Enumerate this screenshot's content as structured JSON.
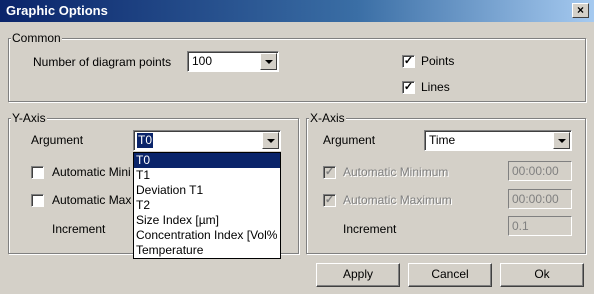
{
  "window": {
    "title": "Graphic Options",
    "close_label": "×"
  },
  "common": {
    "legend": "Common",
    "points_label": "Number of diagram points",
    "points_value": "100",
    "points_checkbox": {
      "label": "Points",
      "checked": true
    },
    "lines_checkbox": {
      "label": "Lines",
      "checked": true
    }
  },
  "y_axis": {
    "legend": "Y-Axis",
    "argument_label": "Argument",
    "argument_value": "T0",
    "auto_min_label": "Automatic Mini",
    "auto_max_label": "Automatic Max",
    "increment_label": "Increment",
    "dropdown_options": [
      "T0",
      "T1",
      "Deviation T1",
      "T2",
      "Size Index [µm]",
      "Concentration Index [Vol%",
      "Temperature"
    ],
    "selected_index": 0
  },
  "x_axis": {
    "legend": "X-Axis",
    "argument_label": "Argument",
    "argument_value": "Time",
    "auto_min_label": "Automatic Minimum",
    "auto_max_label": "Automatic Maximum",
    "auto_min_value": "00:00:00",
    "auto_max_value": "00:00:00",
    "increment_label": "Increment",
    "increment_value": "0.1"
  },
  "buttons": {
    "apply": "Apply",
    "cancel": "Cancel",
    "ok": "Ok"
  },
  "colors": {
    "titlebar": "#0a246a",
    "face": "#d4d0c8",
    "selection": "#0a246a"
  }
}
